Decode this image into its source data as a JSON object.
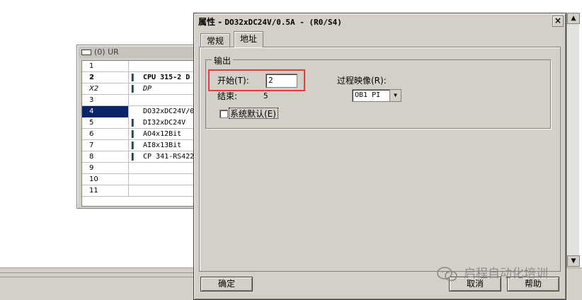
{
  "rack": {
    "title": "(0) UR",
    "rows": [
      {
        "slot": "1",
        "module": ""
      },
      {
        "slot": "2",
        "module": "CPU 315-2 D"
      },
      {
        "slot": "X2",
        "module": "DP"
      },
      {
        "slot": "3",
        "module": ""
      },
      {
        "slot": "4",
        "module": "DO32xDC24V/0"
      },
      {
        "slot": "5",
        "module": "DI32xDC24V"
      },
      {
        "slot": "6",
        "module": "AO4x12Bit"
      },
      {
        "slot": "7",
        "module": "AI8x13Bit"
      },
      {
        "slot": "8",
        "module": "CP 341-RS422"
      },
      {
        "slot": "9",
        "module": ""
      },
      {
        "slot": "10",
        "module": ""
      },
      {
        "slot": "11",
        "module": ""
      }
    ]
  },
  "dialog": {
    "title_prefix": "属性 - ",
    "title_rest": "DO32xDC24V/0.5A - (R0/S4)",
    "close_label": "×",
    "tabs": [
      "常规",
      "地址"
    ],
    "active_tab": "地址",
    "group_title": "输出",
    "start_label": "开始(T):",
    "start_value": "2",
    "end_label": "结束:",
    "end_value": "5",
    "process_image_label": "过程映像(R):",
    "process_image_value": "OB1 PI",
    "system_default_label": "系统默认(E)",
    "system_default_checked": false,
    "ok_label": "确定",
    "cancel_label": "取消",
    "help_label": "帮助"
  },
  "watermark": {
    "text": "启程自动化培训"
  },
  "colors": {
    "dialog_bg": "#d4d0c8",
    "selection": "#0a246a",
    "highlight_box": "#e0403c"
  }
}
